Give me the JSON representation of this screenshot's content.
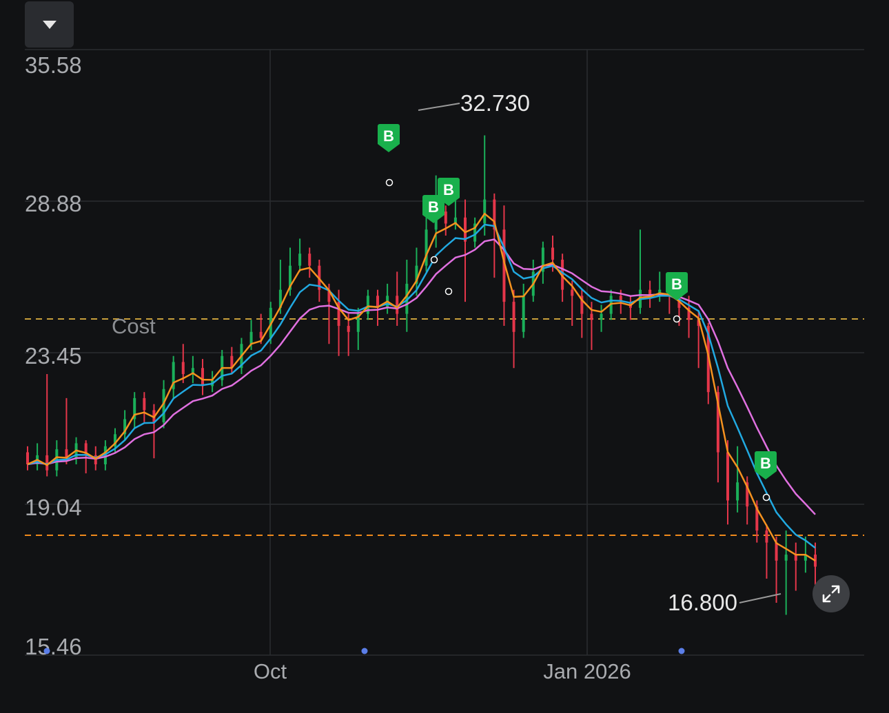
{
  "controls": {
    "dropdown_icon": "caret-down-icon",
    "expand_icon": "expand-arrows-icon"
  },
  "colors": {
    "background": "#111214",
    "grid": "#2a2c30",
    "up": "#1bb05a",
    "down": "#e5364a",
    "ma_short": "#f5921f",
    "ma_mid": "#21a9e1",
    "ma_long": "#e070e0",
    "cost_line": "#c9a03c",
    "price_line": "#f08a1c",
    "buy_marker": "#19b04c",
    "event_dot": "#5b7ee8"
  },
  "chart_data": {
    "type": "candlestick",
    "y_ticks": [
      "35.58",
      "28.88",
      "23.45",
      "19.04",
      "15.46"
    ],
    "x_ticks": [
      "Oct",
      "Jan 2026"
    ],
    "cost_label": "Cost",
    "cost_value": 24.2,
    "current_price_line": 18.5,
    "high_label": "32.730",
    "low_label": "16.800",
    "high_value": 32.73,
    "low_value": 16.8,
    "buy_marker_label": "B",
    "buy_markers_count": 5,
    "event_dots_count": 3,
    "candles": [
      [
        22.2,
        21.8,
        22.4,
        21.6
      ],
      [
        21.8,
        22.1,
        22.5,
        21.6
      ],
      [
        22.1,
        21.6,
        24.8,
        21.4
      ],
      [
        21.6,
        22.3,
        22.6,
        21.4
      ],
      [
        22.3,
        22.0,
        24.0,
        21.8
      ],
      [
        22.0,
        22.5,
        22.7,
        21.8
      ],
      [
        22.5,
        22.1,
        22.6,
        21.5
      ],
      [
        22.1,
        21.8,
        22.4,
        21.6
      ],
      [
        21.8,
        22.4,
        22.6,
        21.6
      ],
      [
        22.4,
        22.8,
        23.0,
        22.2
      ],
      [
        22.8,
        23.3,
        23.6,
        22.6
      ],
      [
        23.3,
        24.0,
        24.2,
        23.0
      ],
      [
        24.0,
        23.6,
        24.2,
        23.2
      ],
      [
        23.6,
        23.2,
        23.8,
        22.0
      ],
      [
        23.2,
        24.3,
        24.6,
        23.0
      ],
      [
        24.3,
        25.2,
        25.4,
        24.0
      ],
      [
        25.2,
        24.8,
        25.8,
        24.5
      ],
      [
        24.8,
        25.0,
        25.4,
        24.5
      ],
      [
        25.0,
        24.4,
        25.3,
        24.1
      ],
      [
        24.4,
        24.6,
        24.9,
        24.2
      ],
      [
        24.6,
        25.4,
        25.6,
        24.4
      ],
      [
        25.4,
        25.0,
        25.7,
        24.8
      ],
      [
        25.0,
        25.8,
        26.0,
        24.8
      ],
      [
        25.8,
        26.2,
        26.6,
        25.6
      ],
      [
        26.2,
        26.0,
        26.8,
        25.8
      ],
      [
        26.0,
        27.0,
        27.2,
        25.8
      ],
      [
        27.0,
        27.6,
        28.6,
        26.8
      ],
      [
        27.6,
        28.4,
        29.0,
        27.4
      ],
      [
        28.4,
        28.8,
        29.3,
        28.2
      ],
      [
        28.8,
        28.4,
        29.0,
        28.0
      ],
      [
        28.4,
        27.6,
        28.6,
        27.2
      ],
      [
        27.6,
        27.2,
        27.8,
        25.8
      ],
      [
        27.2,
        26.4,
        27.6,
        25.4
      ],
      [
        26.4,
        26.2,
        26.8,
        25.4
      ],
      [
        26.2,
        26.8,
        27.0,
        25.6
      ],
      [
        26.8,
        27.4,
        27.6,
        26.6
      ],
      [
        27.4,
        27.0,
        27.6,
        26.4
      ],
      [
        27.0,
        27.4,
        27.8,
        26.8
      ],
      [
        27.4,
        26.8,
        28.2,
        26.4
      ],
      [
        26.8,
        27.8,
        28.6,
        26.2
      ],
      [
        27.8,
        28.4,
        29.0,
        27.4
      ],
      [
        28.4,
        29.6,
        30.2,
        28.2
      ],
      [
        29.6,
        30.2,
        31.4,
        29.0
      ],
      [
        30.2,
        29.8,
        30.4,
        29.4
      ],
      [
        29.8,
        30.0,
        30.8,
        29.6
      ],
      [
        30.0,
        29.2,
        30.6,
        27.2
      ],
      [
        29.2,
        29.8,
        30.0,
        29.0
      ],
      [
        29.8,
        30.6,
        32.73,
        29.4
      ],
      [
        30.6,
        29.6,
        30.8,
        28.0
      ],
      [
        29.6,
        27.2,
        30.4,
        26.4
      ],
      [
        27.2,
        26.2,
        27.6,
        25.0
      ],
      [
        26.2,
        27.4,
        27.8,
        26.0
      ],
      [
        27.4,
        28.2,
        28.6,
        27.2
      ],
      [
        28.2,
        29.0,
        29.2,
        27.8
      ],
      [
        29.0,
        28.6,
        29.4,
        28.2
      ],
      [
        28.6,
        27.6,
        28.8,
        27.2
      ],
      [
        27.6,
        27.4,
        27.9,
        26.4
      ],
      [
        27.4,
        26.8,
        27.6,
        26.0
      ],
      [
        26.8,
        26.6,
        27.2,
        25.6
      ],
      [
        26.6,
        26.8,
        27.1,
        26.2
      ],
      [
        26.8,
        27.4,
        27.6,
        26.6
      ],
      [
        27.4,
        27.2,
        27.6,
        26.8
      ],
      [
        27.2,
        27.0,
        27.4,
        26.6
      ],
      [
        27.0,
        27.6,
        29.6,
        26.8
      ],
      [
        27.6,
        27.4,
        27.9,
        27.0
      ],
      [
        27.4,
        27.6,
        28.2,
        27.2
      ],
      [
        27.6,
        27.4,
        28.0,
        26.8
      ],
      [
        27.4,
        27.0,
        27.6,
        26.4
      ],
      [
        27.0,
        26.6,
        27.4,
        26.0
      ],
      [
        26.6,
        26.4,
        26.9,
        25.0
      ],
      [
        26.4,
        24.2,
        26.5,
        23.8
      ],
      [
        24.2,
        22.2,
        24.4,
        21.2
      ],
      [
        22.2,
        20.6,
        22.6,
        19.8
      ],
      [
        20.6,
        21.2,
        22.4,
        20.2
      ],
      [
        21.2,
        20.4,
        21.4,
        19.8
      ],
      [
        20.4,
        19.6,
        20.6,
        19.2
      ],
      [
        19.6,
        19.2,
        19.8,
        18.0
      ],
      [
        19.2,
        18.6,
        19.4,
        17.2
      ],
      [
        18.6,
        18.8,
        19.6,
        16.8
      ],
      [
        18.8,
        18.6,
        19.2,
        17.6
      ],
      [
        18.6,
        18.8,
        19.4,
        18.2
      ],
      [
        18.8,
        18.4,
        19.2,
        17.8
      ]
    ]
  }
}
